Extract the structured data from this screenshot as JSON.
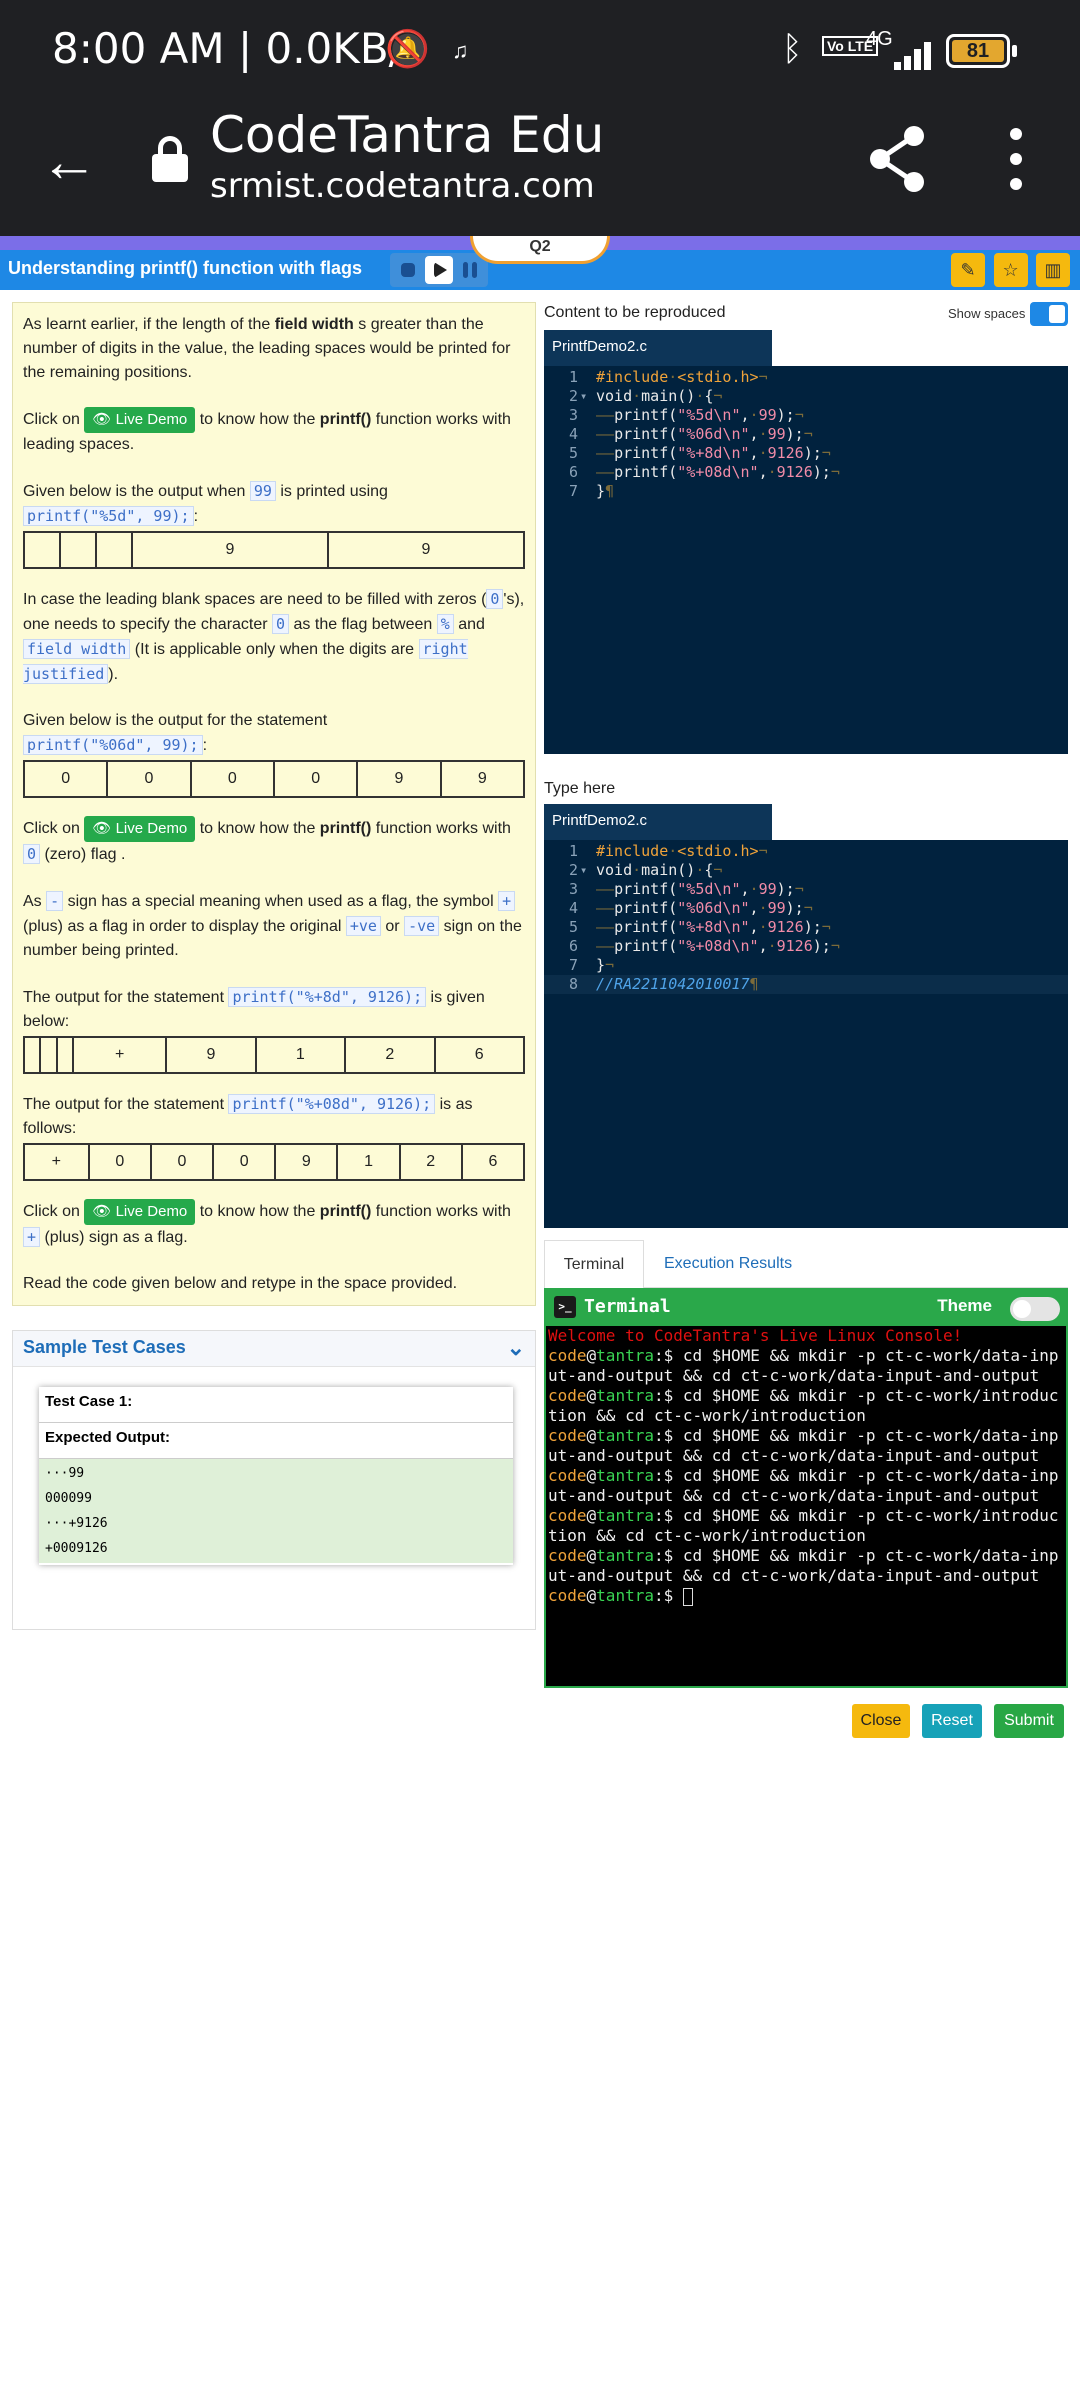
{
  "status_bar": {
    "time": "8:00 AM | 0.0KB/s",
    "volte": "Vo LTE",
    "network": "4G",
    "battery": "81"
  },
  "browser": {
    "title": "CodeTantra Edu",
    "url": "srmist.codetantra.com"
  },
  "question_tab": "Q2",
  "header": {
    "title": "Understanding printf() function with flags"
  },
  "lesson": {
    "p1_a": "As learnt earlier, if the length of the ",
    "p1_b": "field width",
    "p1_c": " s greater than the number of digits in the value, the leading spaces would be printed for the remaining positions.",
    "click_on": "Click on",
    "live_demo": "Live Demo",
    "p2_b": " to know how the ",
    "printf_bold": "printf()",
    "p2_c": " function works with leading spaces.",
    "p3_a": "Given below is the output when ",
    "p3_code1": "99",
    "p3_b": " is printed using",
    "p3_code2": "printf(\"%5d\", 99);",
    "p3_c": ":",
    "table1": [
      "",
      "",
      "",
      "9",
      "9"
    ],
    "p4_a": "In case the leading blank spaces are need to be filled with zeros (",
    "p4_code1": "0",
    "p4_b": "'s), one needs to specify the character ",
    "p4_code2": "0",
    "p4_c": " as the flag between ",
    "p4_code3": "%",
    "p4_d": " and ",
    "p4_code4": "field width",
    "p4_e": " (It is applicable only when the digits are ",
    "p4_code5": "right justified",
    "p4_f": ").",
    "p5_a": "Given below is the output for the statement",
    "p5_code": "printf(\"%06d\", 99);",
    "p5_b": ":",
    "table2": [
      "0",
      "0",
      "0",
      "0",
      "9",
      "9"
    ],
    "p6_c": " function works with",
    "p6_code": "0",
    "p6_d": " (zero) flag .",
    "p7_a": "As ",
    "p7_code1": "-",
    "p7_b": " sign has a special meaning when used as a flag, the symbol ",
    "p7_code2": "+",
    "p7_c": " (plus) as a flag in order to display the original ",
    "p7_code3": "+ve",
    "p7_d": " or ",
    "p7_code4": "-ve",
    "p7_e": " sign on the number being printed.",
    "p8_a": "The output for the statement ",
    "p8_code": "printf(\"%+8d\", 9126);",
    "p8_b": " is given below:",
    "table3": [
      "",
      "",
      "",
      "+",
      "9",
      "1",
      "2",
      "6"
    ],
    "p9_a": "The output for the statement ",
    "p9_code": "printf(\"%+08d\", 9126);",
    "p9_b": " is as follows:",
    "table4": [
      "+",
      "0",
      "0",
      "0",
      "9",
      "1",
      "2",
      "6"
    ],
    "p10_c": " function works with",
    "p10_code": "+",
    "p10_d": " (plus) sign as a flag.",
    "p11": "Read the code given below and retype in the space provided."
  },
  "sample": {
    "title": "Sample Test Cases",
    "test_case": "Test Case 1:",
    "expected": "Expected Output:",
    "outputs": [
      "···99",
      "000099",
      "···+9126",
      "+0009126"
    ]
  },
  "editor1": {
    "label": "Content to be reproduced",
    "show_spaces": "Show spaces",
    "file": "PrintfDemo2.c"
  },
  "editor2": {
    "label": "Type here",
    "file": "PrintfDemo2.c",
    "comment": "//RA2211042010017"
  },
  "tabs": {
    "terminal": "Terminal",
    "results": "Execution Results"
  },
  "terminal": {
    "title": "Terminal",
    "theme": "Theme",
    "welcome": "Welcome to CodeTantra's Live Linux Console!",
    "user": "code",
    "host": "tantra",
    "prompt": ":$",
    "cmd_a": " cd $HOME && mkdir -p ct-c-work/data-input-and-output && cd ct-c-work/data-input-and-output",
    "cmd_b": " cd $HOME && mkdir -p ct-c-work/introduction && cd ct-c-work/introduction"
  },
  "buttons": {
    "close": "Close",
    "reset": "Reset",
    "submit": "Submit"
  },
  "colors": {
    "accent_blue": "#1e88e5",
    "live_demo_green": "#25a94b",
    "close_yellow": "#f5b90e",
    "reset_teal": "#17a2b8",
    "submit_green": "#28a745"
  }
}
